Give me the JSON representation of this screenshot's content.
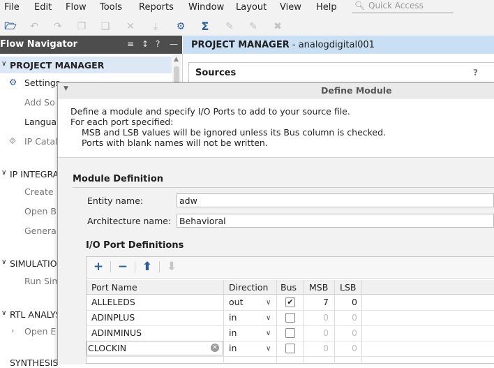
{
  "menubar": {
    "items": [
      "Edit",
      "Flow",
      "Tools",
      "Reports",
      "Window",
      "Layout",
      "View",
      "Help"
    ],
    "quick_access_placeholder": "Quick Access"
  },
  "flow_navigator": {
    "title": "Flow Navigator",
    "sections": {
      "project_manager": "PROJECT MANAGER",
      "settings": "Settings",
      "add_sources": "Add So",
      "language": "Langua",
      "ip_catalog": "IP Catal",
      "ip_integrator": "IP INTEGRA",
      "create": "Create",
      "open_block": "Open B",
      "generate": "Genera",
      "simulation": "SIMULATION",
      "run_sim": "Run Sim",
      "rtl_analysis": "RTL ANALYS",
      "open_elaborated": "Open E",
      "synthesis": "SYNTHESIS"
    }
  },
  "right_panel": {
    "title_bold": "PROJECT MANAGER",
    "title_rest": " - analogdigital001",
    "sources_title": "Sources",
    "help": "?"
  },
  "dialog": {
    "title": "Define Module",
    "description": [
      "Define a module and specify I/O Ports to add to your source file.",
      "For each port specified:",
      "MSB and LSB values will be ignored unless its Bus column is checked.",
      "Ports with blank names will not be written."
    ],
    "module_definition": {
      "title": "Module Definition",
      "entity_label": "Entity name:",
      "entity_value": "adw",
      "arch_label": "Architecture name:",
      "arch_value": "Behavioral"
    },
    "io_ports": {
      "title": "I/O Port Definitions",
      "columns": [
        "Port Name",
        "Direction",
        "Bus",
        "MSB",
        "LSB"
      ],
      "rows": [
        {
          "name": "ALLELEDS",
          "direction": "out",
          "bus": true,
          "msb": "7",
          "lsb": "0"
        },
        {
          "name": "ADINPLUS",
          "direction": "in",
          "bus": false,
          "msb": "0",
          "lsb": "0"
        },
        {
          "name": "ADINMINUS",
          "direction": "in",
          "bus": false,
          "msb": "0",
          "lsb": "0"
        },
        {
          "name": "CLOCKIN",
          "direction": "in",
          "bus": false,
          "msb": "0",
          "lsb": "0"
        }
      ]
    }
  }
}
